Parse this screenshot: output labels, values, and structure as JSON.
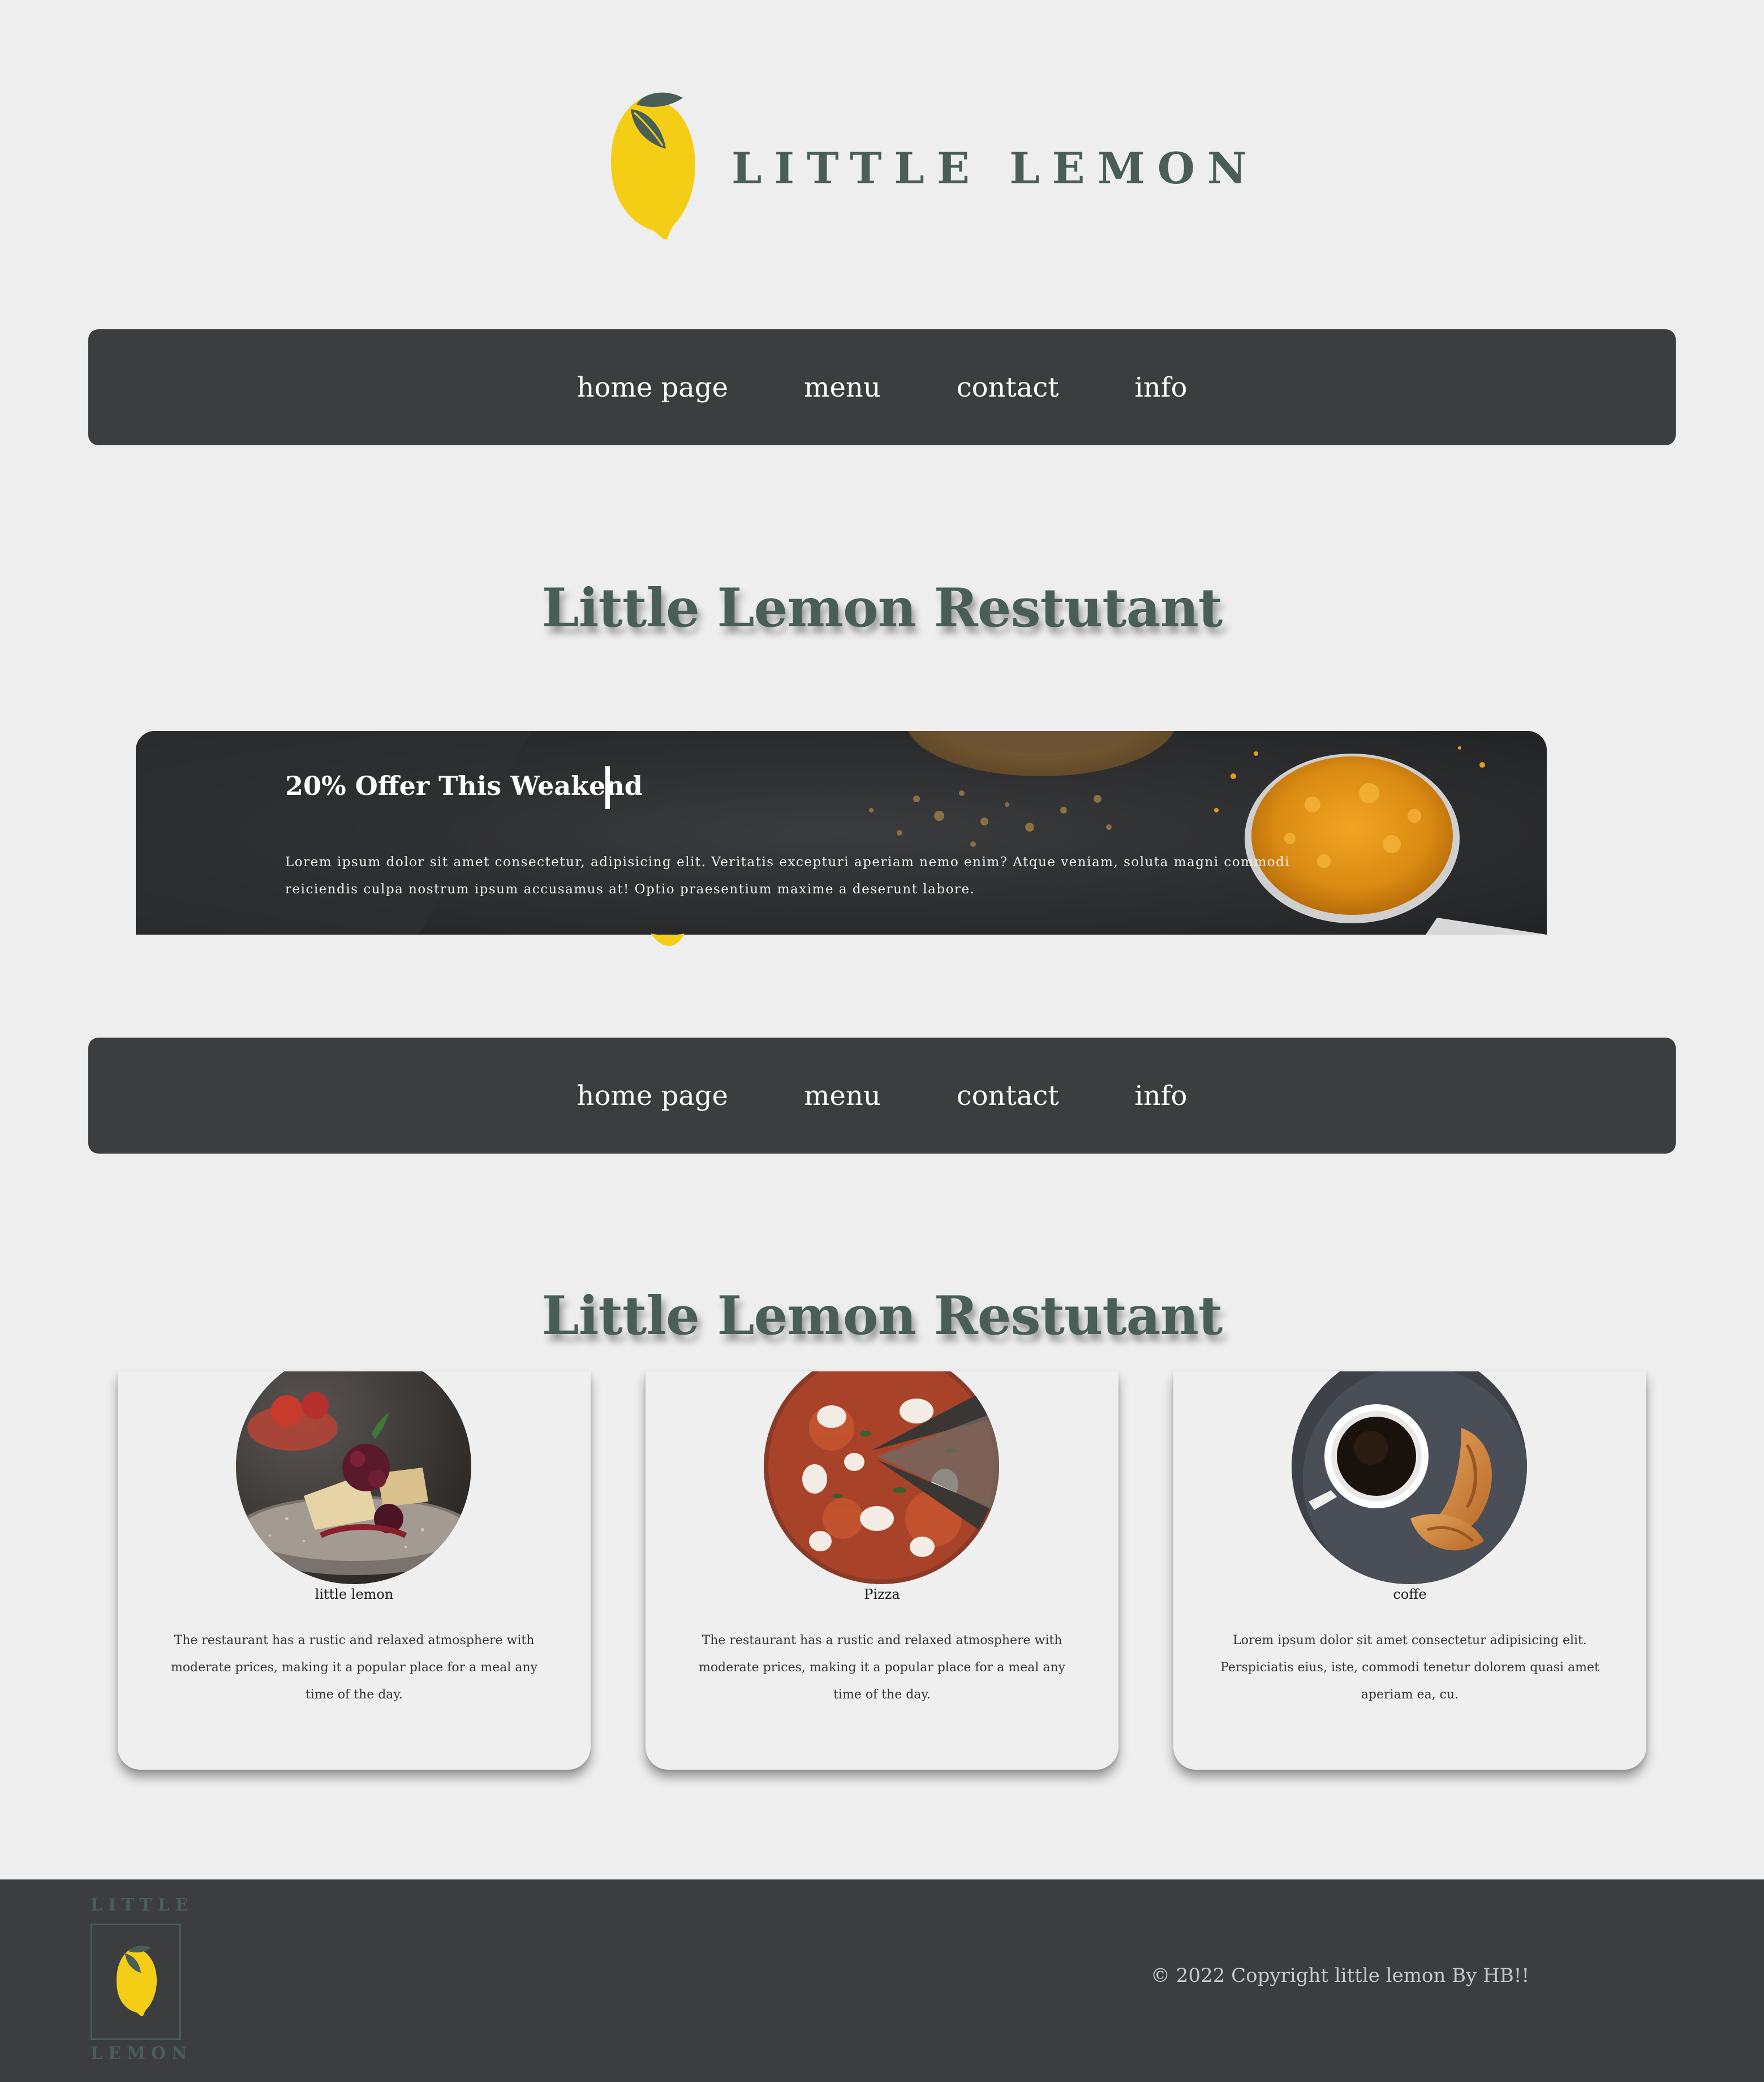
{
  "header": {
    "logo_text": "LITTLE LEMON",
    "brand_colors": {
      "lemon": "#f4ce14",
      "green": "#495e57",
      "dark": "#3c3d3f"
    }
  },
  "nav_top": {
    "items": [
      {
        "label": "home page"
      },
      {
        "label": "menu"
      },
      {
        "label": "contact"
      },
      {
        "label": "info"
      }
    ]
  },
  "nav_bottom": {
    "items": [
      {
        "label": "home page"
      },
      {
        "label": "menu"
      },
      {
        "label": "contact"
      },
      {
        "label": "info"
      }
    ]
  },
  "sections": {
    "heading_1": "Little Lemon Restutant",
    "heading_2": "Little Lemon Restutant"
  },
  "banner": {
    "title": "20% Offer This Weakend",
    "text": "Lorem ipsum dolor sit amet consectetur, adipisicing elit. Veritatis excepturi aperiam nemo enim? Atque veniam, soluta magni commodi reiciendis culpa nostrum ipsum accusamus at! Optio praesentium maxime a deserunt labore."
  },
  "cards": [
    {
      "icon": "dessert-image",
      "name": "little lemon",
      "description": "The restaurant has a rustic and relaxed atmosphere with moderate prices, making it a popular place for a meal any time of the day."
    },
    {
      "icon": "pizza-image",
      "name": "Pizza",
      "description": "The restaurant has a rustic and relaxed atmosphere with moderate prices, making it a popular place for a meal any time of the day."
    },
    {
      "icon": "coffee-image",
      "name": "coffe",
      "description": "Lorem ipsum dolor sit amet consectetur adipisicing elit. Perspiciatis eius, iste, commodi tenetur dolorem quasi amet aperiam ea, cu."
    }
  ],
  "footer": {
    "logo_top": "LITTLE",
    "logo_bottom": "LEMON",
    "copyright": "© 2022 Copyright little lemon By HB!!"
  }
}
